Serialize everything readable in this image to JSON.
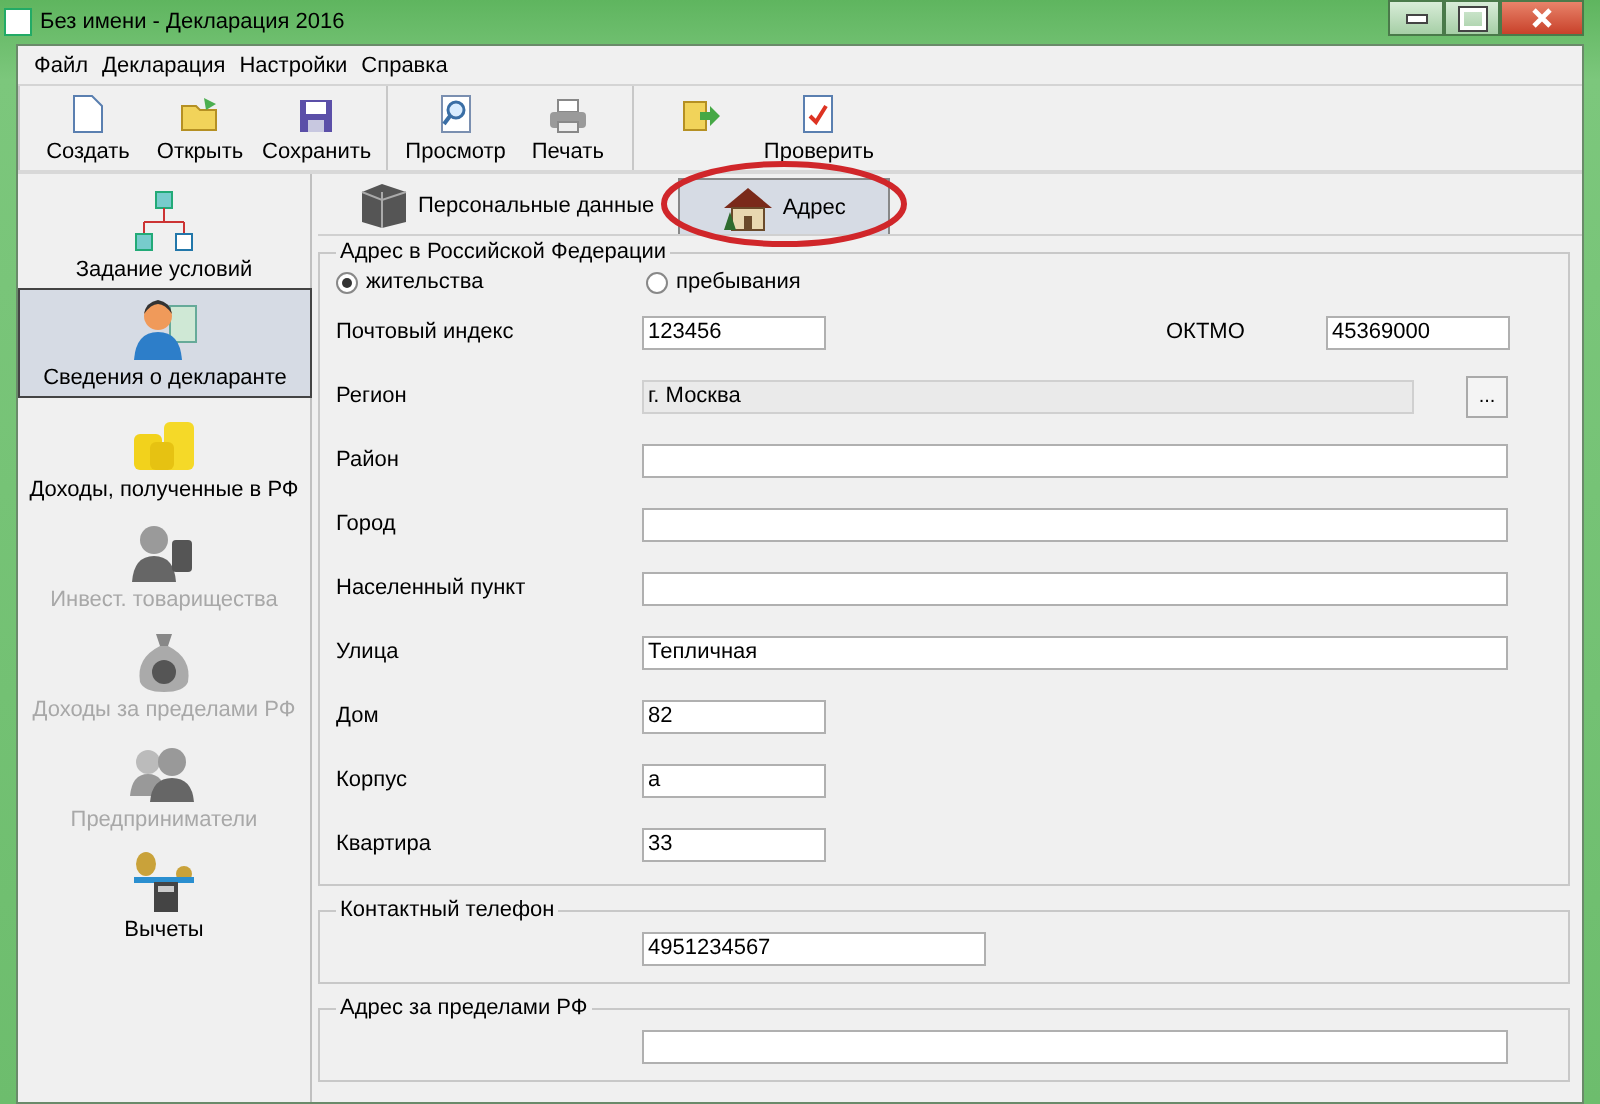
{
  "window": {
    "title": "Без имени - Декларация 2016"
  },
  "menu": [
    "Файл",
    "Декларация",
    "Настройки",
    "Справка"
  ],
  "toolbar": [
    [
      {
        "label": "Создать",
        "kind": "new"
      },
      {
        "label": "Открыть",
        "kind": "open"
      },
      {
        "label": "Сохранить",
        "kind": "save"
      }
    ],
    [
      {
        "label": "Просмотр",
        "kind": "preview"
      },
      {
        "label": "Печать",
        "kind": "print"
      }
    ],
    [
      {
        "kind": "export"
      },
      {
        "label": "Проверить",
        "kind": "check"
      }
    ]
  ],
  "sidebar": {
    "items": [
      {
        "label": "Задание условий",
        "selected": false,
        "disabled": false,
        "kind": "tree"
      },
      {
        "label": "Сведения о декларанте",
        "selected": true,
        "disabled": false,
        "kind": "person"
      },
      {
        "label": "Доходы, полученные в РФ",
        "selected": false,
        "disabled": false,
        "kind": "coins"
      },
      {
        "label": "Инвест. товарищества",
        "selected": false,
        "disabled": true,
        "kind": "investor"
      },
      {
        "label": "Доходы за пределами РФ",
        "selected": false,
        "disabled": true,
        "kind": "moneybag"
      },
      {
        "label": "Предприниматели",
        "selected": false,
        "disabled": true,
        "kind": "group"
      },
      {
        "label": "Вычеты",
        "selected": false,
        "disabled": false,
        "kind": "scales"
      }
    ]
  },
  "tabs": [
    {
      "label": "Персональные данные",
      "selected": false,
      "kind": "cube"
    },
    {
      "label": "Адрес",
      "selected": true,
      "kind": "house",
      "highlighted": true
    }
  ],
  "address_rf": {
    "title": "Адрес в Российской Федерации",
    "radios": [
      {
        "label": "жительства",
        "selected": true
      },
      {
        "label": "пребывания",
        "selected": false
      }
    ],
    "postal": {
      "label": "Почтовый индекс",
      "value": "123456"
    },
    "oktmo": {
      "label": "ОКТМО",
      "value": "45369000"
    },
    "fields": [
      {
        "label": "Регион",
        "value": "г. Москва",
        "kind": "readonly",
        "button": "..."
      },
      {
        "label": "Район",
        "kind": "full"
      },
      {
        "label": "Город",
        "kind": "full"
      },
      {
        "label": "Населенный пункт",
        "kind": "full"
      },
      {
        "label": "Улица",
        "value": "Тепличная",
        "kind": "full"
      },
      {
        "label": "Дом",
        "value": "82",
        "kind": "short"
      },
      {
        "label": "Корпус",
        "value": "а",
        "kind": "short"
      },
      {
        "label": "Квартира",
        "value": "33",
        "kind": "short"
      }
    ]
  },
  "contact": {
    "title": "Контактный телефон",
    "value": "4951234567"
  },
  "address_abroad": {
    "title": "Адрес за пределами РФ"
  }
}
